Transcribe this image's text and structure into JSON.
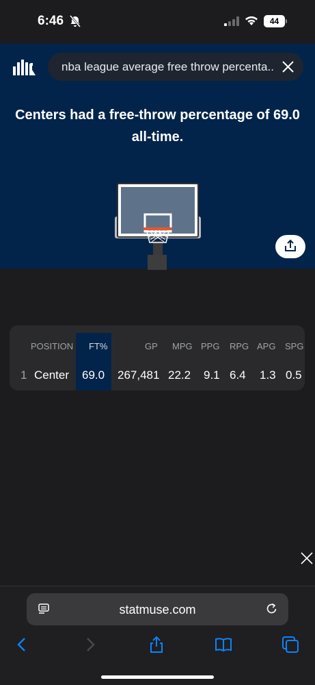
{
  "status_bar": {
    "time": "6:46",
    "battery": "44"
  },
  "search": {
    "query": "nba league average free throw percenta..."
  },
  "headline": "Centers had a free-throw percentage of 69.0 all-time.",
  "table": {
    "headers": [
      "POSITION",
      "FT%",
      "GP",
      "MPG",
      "PPG",
      "RPG",
      "APG",
      "SPG"
    ],
    "rows": [
      {
        "rank": "1",
        "position": "Center",
        "ft_pct": "69.0",
        "gp": "267,481",
        "mpg": "22.2",
        "ppg": "9.1",
        "rpg": "6.4",
        "apg": "1.3",
        "spg": "0.5"
      }
    ]
  },
  "browser": {
    "url": "statmuse.com"
  },
  "colors": {
    "hero_bg": "#03244a",
    "page_bg": "#1c1c1e",
    "accent_blue": "#0a84ff"
  }
}
